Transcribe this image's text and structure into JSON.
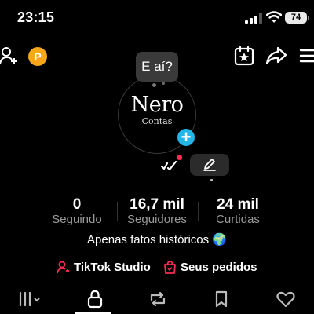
{
  "status_bar": {
    "time": "23:15",
    "battery": "74"
  },
  "top_nav": {
    "coin_label": "P"
  },
  "profile": {
    "bubble_text": "E aí?",
    "avatar_name": "Nero",
    "avatar_sub": "Contas",
    "plus_label": "+"
  },
  "stats": [
    {
      "value": "0",
      "label": "Seguindo"
    },
    {
      "value": "16,7 mil",
      "label": "Seguidores"
    },
    {
      "value": "24 mil",
      "label": "Curtidas"
    }
  ],
  "bio": "Apenas fatos históricos 🌍",
  "links": {
    "studio_label": "TikTok Studio",
    "orders_label": "Seus pedidos"
  },
  "colors": {
    "accent_blue": "#21b5e8",
    "accent_red": "#fe2c55",
    "coin": "#f6a71a"
  },
  "icons": [
    "add-user-icon",
    "coin-icon",
    "calendar-star-icon",
    "share-icon",
    "menu-icon",
    "edit-icon",
    "grid-icon",
    "lock-icon",
    "repost-icon",
    "bookmark-icon",
    "heart-icon"
  ]
}
